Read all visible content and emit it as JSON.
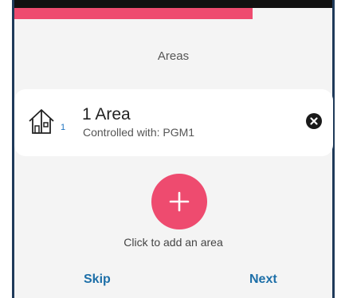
{
  "progress": {
    "fraction": 0.75,
    "color": "#ee4b6f"
  },
  "header": {
    "title": "Areas"
  },
  "area_card": {
    "count": "1",
    "name": "1 Area",
    "subtitle": "Controlled with: PGM1",
    "icon": "house-icon",
    "remove_icon": "close-circle-icon"
  },
  "add_area": {
    "icon": "plus-icon",
    "label": "Click to add an area",
    "color": "#ee4b6f"
  },
  "footer": {
    "skip_label": "Skip",
    "next_label": "Next",
    "link_color": "#1d6fa8"
  }
}
